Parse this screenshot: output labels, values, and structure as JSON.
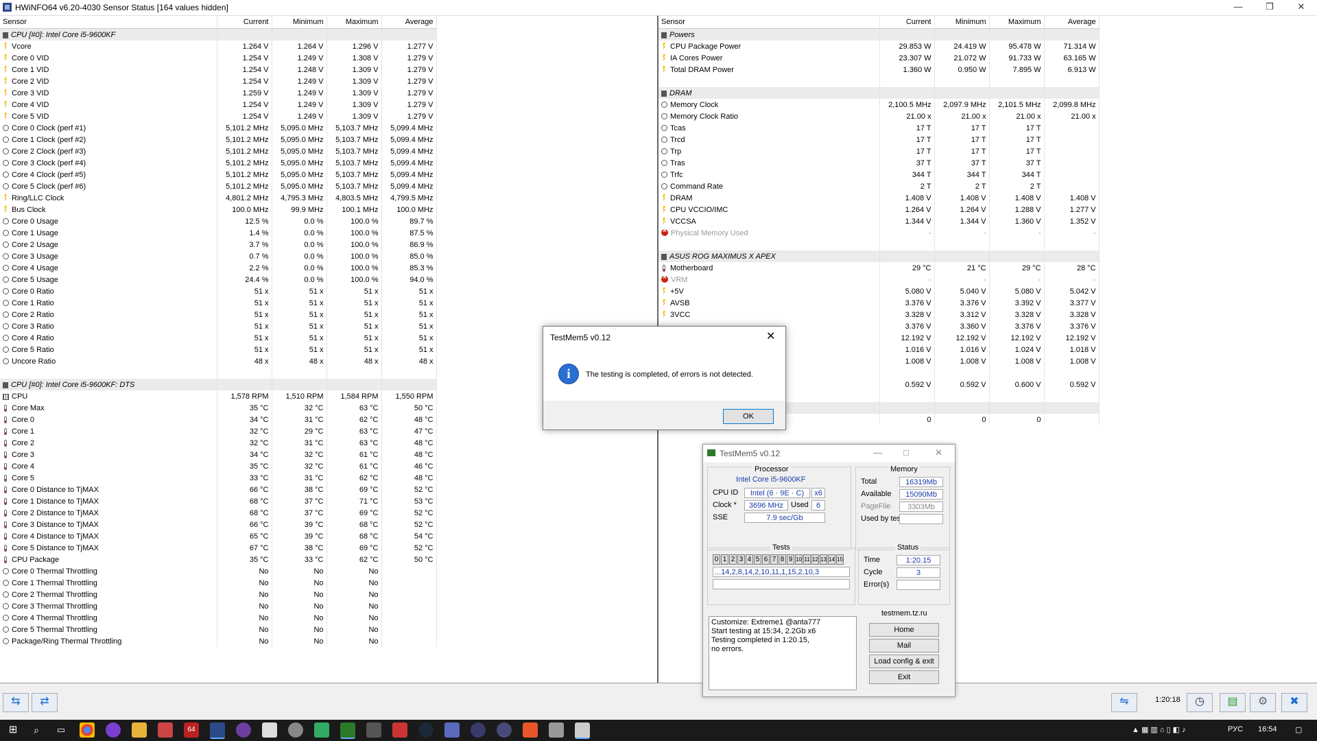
{
  "window": {
    "title": "HWiNFO64 v6.20-4030 Sensor Status [164 values hidden]"
  },
  "columns": {
    "sensor": "Sensor",
    "current": "Current",
    "minimum": "Minimum",
    "maximum": "Maximum",
    "average": "Average"
  },
  "left_rows": [
    {
      "t": "group",
      "name": "CPU [#0]: Intel Core i5-9600KF"
    },
    {
      "t": "volt",
      "name": "Vcore",
      "cur": "1.264 V",
      "min": "1.264 V",
      "max": "1.296 V",
      "avg": "1.277 V"
    },
    {
      "t": "volt",
      "name": "Core 0 VID",
      "cur": "1.254 V",
      "min": "1.249 V",
      "max": "1.308 V",
      "avg": "1.279 V"
    },
    {
      "t": "volt",
      "name": "Core 1 VID",
      "cur": "1.254 V",
      "min": "1.248 V",
      "max": "1.309 V",
      "avg": "1.279 V"
    },
    {
      "t": "volt",
      "name": "Core 2 VID",
      "cur": "1.254 V",
      "min": "1.249 V",
      "max": "1.309 V",
      "avg": "1.279 V"
    },
    {
      "t": "volt",
      "name": "Core 3 VID",
      "cur": "1.259 V",
      "min": "1.249 V",
      "max": "1.309 V",
      "avg": "1.279 V"
    },
    {
      "t": "volt",
      "name": "Core 4 VID",
      "cur": "1.254 V",
      "min": "1.249 V",
      "max": "1.309 V",
      "avg": "1.279 V"
    },
    {
      "t": "volt",
      "name": "Core 5 VID",
      "cur": "1.254 V",
      "min": "1.249 V",
      "max": "1.309 V",
      "avg": "1.279 V"
    },
    {
      "t": "clock",
      "name": "Core 0 Clock (perf #1)",
      "cur": "5,101.2 MHz",
      "min": "5,095.0 MHz",
      "max": "5,103.7 MHz",
      "avg": "5,099.4 MHz"
    },
    {
      "t": "clock",
      "name": "Core 1 Clock (perf #2)",
      "cur": "5,101.2 MHz",
      "min": "5,095.0 MHz",
      "max": "5,103.7 MHz",
      "avg": "5,099.4 MHz"
    },
    {
      "t": "clock",
      "name": "Core 2 Clock (perf #3)",
      "cur": "5,101.2 MHz",
      "min": "5,095.0 MHz",
      "max": "5,103.7 MHz",
      "avg": "5,099.4 MHz"
    },
    {
      "t": "clock",
      "name": "Core 3 Clock (perf #4)",
      "cur": "5,101.2 MHz",
      "min": "5,095.0 MHz",
      "max": "5,103.7 MHz",
      "avg": "5,099.4 MHz"
    },
    {
      "t": "clock",
      "name": "Core 4 Clock (perf #5)",
      "cur": "5,101.2 MHz",
      "min": "5,095.0 MHz",
      "max": "5,103.7 MHz",
      "avg": "5,099.4 MHz"
    },
    {
      "t": "clock",
      "name": "Core 5 Clock (perf #6)",
      "cur": "5,101.2 MHz",
      "min": "5,095.0 MHz",
      "max": "5,103.7 MHz",
      "avg": "5,099.4 MHz"
    },
    {
      "t": "volt",
      "name": "Ring/LLC Clock",
      "cur": "4,801.2 MHz",
      "min": "4,795.3 MHz",
      "max": "4,803.5 MHz",
      "avg": "4,799.5 MHz"
    },
    {
      "t": "volt",
      "name": "Bus Clock",
      "cur": "100.0 MHz",
      "min": "99.9 MHz",
      "max": "100.1 MHz",
      "avg": "100.0 MHz"
    },
    {
      "t": "clock",
      "name": "Core 0 Usage",
      "cur": "12.5 %",
      "min": "0.0 %",
      "max": "100.0 %",
      "avg": "89.7 %"
    },
    {
      "t": "clock",
      "name": "Core 1 Usage",
      "cur": "1.4 %",
      "min": "0.0 %",
      "max": "100.0 %",
      "avg": "87.5 %"
    },
    {
      "t": "clock",
      "name": "Core 2 Usage",
      "cur": "3.7 %",
      "min": "0.0 %",
      "max": "100.0 %",
      "avg": "86.9 %"
    },
    {
      "t": "clock",
      "name": "Core 3 Usage",
      "cur": "0.7 %",
      "min": "0.0 %",
      "max": "100.0 %",
      "avg": "85.0 %"
    },
    {
      "t": "clock",
      "name": "Core 4 Usage",
      "cur": "2.2 %",
      "min": "0.0 %",
      "max": "100.0 %",
      "avg": "85.3 %"
    },
    {
      "t": "clock",
      "name": "Core 5 Usage",
      "cur": "24.4 %",
      "min": "0.0 %",
      "max": "100.0 %",
      "avg": "94.0 %"
    },
    {
      "t": "clock",
      "name": "Core 0 Ratio",
      "cur": "51 x",
      "min": "51 x",
      "max": "51 x",
      "avg": "51 x"
    },
    {
      "t": "clock",
      "name": "Core 1 Ratio",
      "cur": "51 x",
      "min": "51 x",
      "max": "51 x",
      "avg": "51 x"
    },
    {
      "t": "clock",
      "name": "Core 2 Ratio",
      "cur": "51 x",
      "min": "51 x",
      "max": "51 x",
      "avg": "51 x"
    },
    {
      "t": "clock",
      "name": "Core 3 Ratio",
      "cur": "51 x",
      "min": "51 x",
      "max": "51 x",
      "avg": "51 x"
    },
    {
      "t": "clock",
      "name": "Core 4 Ratio",
      "cur": "51 x",
      "min": "51 x",
      "max": "51 x",
      "avg": "51 x"
    },
    {
      "t": "clock",
      "name": "Core 5 Ratio",
      "cur": "51 x",
      "min": "51 x",
      "max": "51 x",
      "avg": "51 x"
    },
    {
      "t": "clock",
      "name": "Uncore Ratio",
      "cur": "48 x",
      "min": "48 x",
      "max": "48 x",
      "avg": "48 x"
    },
    {
      "t": "blank"
    },
    {
      "t": "group",
      "name": "CPU [#0]: Intel Core i5-9600KF: DTS"
    },
    {
      "t": "fan",
      "name": "CPU",
      "cur": "1,578 RPM",
      "min": "1,510 RPM",
      "max": "1,584 RPM",
      "avg": "1,550 RPM"
    },
    {
      "t": "temp",
      "name": "Core Max",
      "cur": "35 °C",
      "min": "32 °C",
      "max": "63 °C",
      "avg": "50 °C"
    },
    {
      "t": "temp",
      "name": "Core 0",
      "cur": "34 °C",
      "min": "31 °C",
      "max": "62 °C",
      "avg": "48 °C"
    },
    {
      "t": "temp",
      "name": "Core 1",
      "cur": "32 °C",
      "min": "29 °C",
      "max": "63 °C",
      "avg": "47 °C"
    },
    {
      "t": "temp",
      "name": "Core 2",
      "cur": "32 °C",
      "min": "31 °C",
      "max": "63 °C",
      "avg": "48 °C"
    },
    {
      "t": "temp",
      "name": "Core 3",
      "cur": "34 °C",
      "min": "32 °C",
      "max": "61 °C",
      "avg": "48 °C"
    },
    {
      "t": "temp",
      "name": "Core 4",
      "cur": "35 °C",
      "min": "32 °C",
      "max": "61 °C",
      "avg": "46 °C"
    },
    {
      "t": "temp",
      "name": "Core 5",
      "cur": "33 °C",
      "min": "31 °C",
      "max": "62 °C",
      "avg": "48 °C"
    },
    {
      "t": "temp",
      "name": "Core 0 Distance to TjMAX",
      "cur": "66 °C",
      "min": "38 °C",
      "max": "69 °C",
      "avg": "52 °C"
    },
    {
      "t": "temp",
      "name": "Core 1 Distance to TjMAX",
      "cur": "68 °C",
      "min": "37 °C",
      "max": "71 °C",
      "avg": "53 °C"
    },
    {
      "t": "temp",
      "name": "Core 2 Distance to TjMAX",
      "cur": "68 °C",
      "min": "37 °C",
      "max": "69 °C",
      "avg": "52 °C"
    },
    {
      "t": "temp",
      "name": "Core 3 Distance to TjMAX",
      "cur": "66 °C",
      "min": "39 °C",
      "max": "68 °C",
      "avg": "52 °C"
    },
    {
      "t": "temp",
      "name": "Core 4 Distance to TjMAX",
      "cur": "65 °C",
      "min": "39 °C",
      "max": "68 °C",
      "avg": "54 °C"
    },
    {
      "t": "temp",
      "name": "Core 5 Distance to TjMAX",
      "cur": "67 °C",
      "min": "38 °C",
      "max": "69 °C",
      "avg": "52 °C"
    },
    {
      "t": "temp",
      "name": "CPU Package",
      "cur": "35 °C",
      "min": "33 °C",
      "max": "62 °C",
      "avg": "50 °C"
    },
    {
      "t": "clock",
      "name": "Core 0 Thermal Throttling",
      "cur": "No",
      "min": "No",
      "max": "No",
      "avg": ""
    },
    {
      "t": "clock",
      "name": "Core 1 Thermal Throttling",
      "cur": "No",
      "min": "No",
      "max": "No",
      "avg": ""
    },
    {
      "t": "clock",
      "name": "Core 2 Thermal Throttling",
      "cur": "No",
      "min": "No",
      "max": "No",
      "avg": ""
    },
    {
      "t": "clock",
      "name": "Core 3 Thermal Throttling",
      "cur": "No",
      "min": "No",
      "max": "No",
      "avg": ""
    },
    {
      "t": "clock",
      "name": "Core 4 Thermal Throttling",
      "cur": "No",
      "min": "No",
      "max": "No",
      "avg": ""
    },
    {
      "t": "clock",
      "name": "Core 5 Thermal Throttling",
      "cur": "No",
      "min": "No",
      "max": "No",
      "avg": ""
    },
    {
      "t": "clock",
      "name": "Package/Ring Thermal Throttling",
      "cur": "No",
      "min": "No",
      "max": "No",
      "avg": ""
    }
  ],
  "right_rows": [
    {
      "t": "group",
      "name": "Powers"
    },
    {
      "t": "volt",
      "name": "CPU Package Power",
      "cur": "29.853 W",
      "min": "24.419 W",
      "max": "95.478 W",
      "avg": "71.314 W"
    },
    {
      "t": "volt",
      "name": "IA Cores Power",
      "cur": "23.307 W",
      "min": "21.072 W",
      "max": "91.733 W",
      "avg": "63.165 W"
    },
    {
      "t": "volt",
      "name": "Total DRAM Power",
      "cur": "1.360 W",
      "min": "0.950 W",
      "max": "7.895 W",
      "avg": "6.913 W"
    },
    {
      "t": "blank"
    },
    {
      "t": "group",
      "name": "DRAM"
    },
    {
      "t": "clock",
      "name": "Memory Clock",
      "cur": "2,100.5 MHz",
      "min": "2,097.9 MHz",
      "max": "2,101.5 MHz",
      "avg": "2,099.8 MHz"
    },
    {
      "t": "clock",
      "name": "Memory Clock Ratio",
      "cur": "21.00 x",
      "min": "21.00 x",
      "max": "21.00 x",
      "avg": "21.00 x"
    },
    {
      "t": "clock",
      "name": "Tcas",
      "cur": "17 T",
      "min": "17 T",
      "max": "17 T",
      "avg": ""
    },
    {
      "t": "clock",
      "name": "Trcd",
      "cur": "17 T",
      "min": "17 T",
      "max": "17 T",
      "avg": ""
    },
    {
      "t": "clock",
      "name": "Trp",
      "cur": "17 T",
      "min": "17 T",
      "max": "17 T",
      "avg": ""
    },
    {
      "t": "clock",
      "name": "Tras",
      "cur": "37 T",
      "min": "37 T",
      "max": "37 T",
      "avg": ""
    },
    {
      "t": "clock",
      "name": "Trfc",
      "cur": "344 T",
      "min": "344 T",
      "max": "344 T",
      "avg": ""
    },
    {
      "t": "clock",
      "name": "Command Rate",
      "cur": "2 T",
      "min": "2 T",
      "max": "2 T",
      "avg": ""
    },
    {
      "t": "volt",
      "name": "DRAM",
      "cur": "1.408 V",
      "min": "1.408 V",
      "max": "1.408 V",
      "avg": "1.408 V"
    },
    {
      "t": "volt",
      "name": "CPU VCCIO/IMC",
      "cur": "1.264 V",
      "min": "1.264 V",
      "max": "1.288 V",
      "avg": "1.277 V"
    },
    {
      "t": "volt",
      "name": "VCCSA",
      "cur": "1.344 V",
      "min": "1.344 V",
      "max": "1.360 V",
      "avg": "1.352 V"
    },
    {
      "t": "err",
      "name": "Physical Memory Used",
      "cur": "-",
      "min": "-",
      "max": "-",
      "avg": "-"
    },
    {
      "t": "blank"
    },
    {
      "t": "group",
      "name": "ASUS ROG MAXIMUS X APEX"
    },
    {
      "t": "temp",
      "name": "Motherboard",
      "cur": "29 °C",
      "min": "21 °C",
      "max": "29 °C",
      "avg": "28 °C"
    },
    {
      "t": "err",
      "name": "VRM",
      "cur": "-",
      "min": "-",
      "max": "-",
      "avg": "-"
    },
    {
      "t": "volt",
      "name": "+5V",
      "cur": "5.080 V",
      "min": "5.040 V",
      "max": "5.080 V",
      "avg": "5.042 V"
    },
    {
      "t": "volt",
      "name": "AVSB",
      "cur": "3.376 V",
      "min": "3.376 V",
      "max": "3.392 V",
      "avg": "3.377 V"
    },
    {
      "t": "volt",
      "name": "3VCC",
      "cur": "3.328 V",
      "min": "3.312 V",
      "max": "3.328 V",
      "avg": "3.328 V"
    },
    {
      "t": "hidden",
      "name": "",
      "cur": "3.376 V",
      "min": "3.360 V",
      "max": "3.376 V",
      "avg": "3.376 V"
    },
    {
      "t": "hidden",
      "name": "",
      "cur": "12.192 V",
      "min": "12.192 V",
      "max": "12.192 V",
      "avg": "12.192 V"
    },
    {
      "t": "hidden",
      "name": "",
      "cur": "1.016 V",
      "min": "1.016 V",
      "max": "1.024 V",
      "avg": "1.018 V"
    },
    {
      "t": "hidden",
      "name": "",
      "cur": "1.008 V",
      "min": "1.008 V",
      "max": "1.008 V",
      "avg": "1.008 V"
    },
    {
      "t": "hidden",
      "name": "",
      "cur": "",
      "min": "",
      "max": "",
      "avg": ""
    },
    {
      "t": "hidden",
      "name": "",
      "cur": "0.592 V",
      "min": "0.592 V",
      "max": "0.600 V",
      "avg": "0.592 V"
    },
    {
      "t": "blank"
    },
    {
      "t": "hidgroup",
      "name": ")"
    },
    {
      "t": "hidden",
      "name": "",
      "cur": "0",
      "min": "0",
      "max": "0",
      "avg": ""
    }
  ],
  "dialog": {
    "title": "TestMem5 v0.12",
    "message": "The testing is completed, of errors is not detected.",
    "ok": "OK",
    "info_glyph": "i",
    "close_glyph": "✕"
  },
  "testmem": {
    "title": "TestMem5 v0.12",
    "processor_label": "Processor",
    "processor_name": "Intel Core i5-9600KF",
    "cpuid_label": "CPU ID",
    "cpuid_value": "Intel  (6 · 9E · C)",
    "threads": "x6",
    "clock_label": "Clock *",
    "clock_value": "3696 MHz",
    "used_label": "Used",
    "used_value": "6",
    "sse_label": "SSE",
    "sse_value": "7.9 sec/Gb",
    "memory_label": "Memory",
    "total_label": "Total",
    "total_value": "16319Mb",
    "available_label": "Available",
    "available_value": "15090Mb",
    "pagefile_label": "PageFile",
    "pagefile_value": "3303Mb",
    "usedbytest_label": "Used by test",
    "tests_label": "Tests",
    "test_cells": [
      "0",
      "1",
      "2",
      "3",
      "4",
      "5",
      "6",
      "7",
      "8",
      "9",
      "10",
      "11",
      "12",
      "13",
      "14",
      "15"
    ],
    "sequence": "...14,2,8,14,2,10,11,1,15,2,10,3",
    "status_label": "Status",
    "time_label": "Time",
    "time_value": "1:20.15",
    "cycle_label": "Cycle",
    "cycle_value": "3",
    "errors_label": "Error(s)",
    "log_lines": [
      "Customize: Extreme1 @anta777",
      "Start testing at 15:34, 2.2Gb x6",
      "Testing completed in 1:20.15,",
      "no errors."
    ],
    "site_label": "testmem.tz.ru",
    "btn_home": "Home",
    "btn_mail": "Mail",
    "btn_load": "Load config & exit",
    "btn_exit": "Exit"
  },
  "statusbar": {
    "timer": "1:20:18"
  },
  "taskbar": {
    "lang": "РУС",
    "time": "16:54"
  },
  "colors": {
    "accent": "#1a3ba8",
    "group_bg": "#ebebeb",
    "taskbar": "#1a1a1a"
  }
}
